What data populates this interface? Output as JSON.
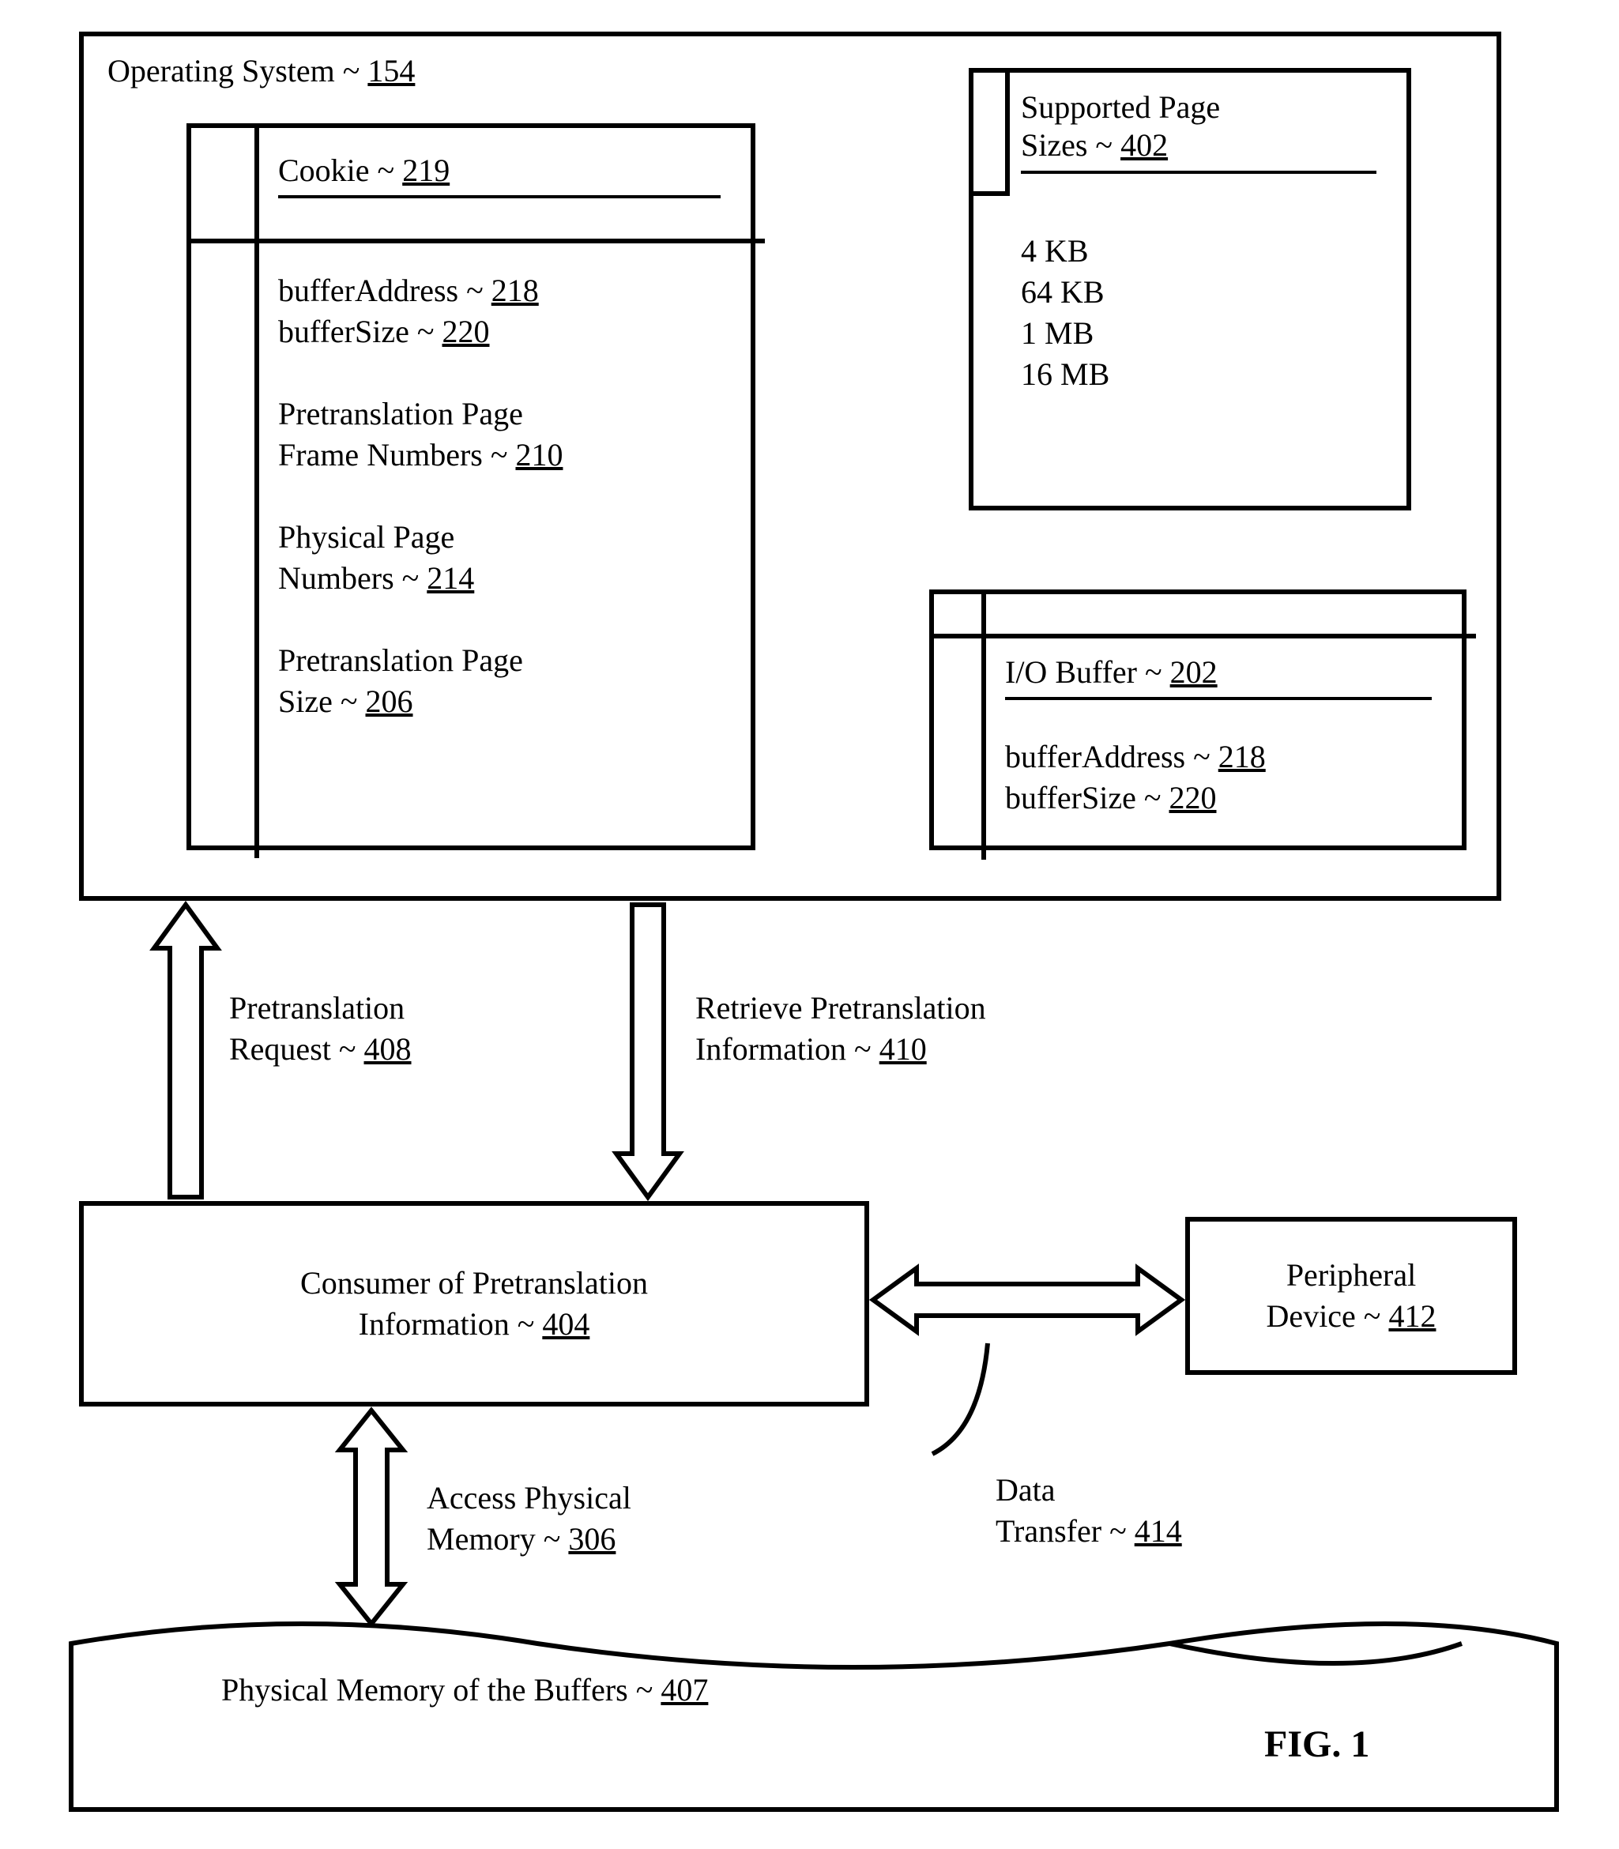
{
  "os": {
    "title_text": "Operating System ~ ",
    "title_ref": "154"
  },
  "cookie": {
    "header_text": "Cookie ~ ",
    "header_ref": "219",
    "line1_text": "bufferAddress ~ ",
    "line1_ref": "218",
    "line2_text": "bufferSize ~ ",
    "line2_ref": "220",
    "line3a": "Pretranslation Page",
    "line3b_text": "Frame Numbers ~ ",
    "line3b_ref": "210",
    "line4a": "Physical Page",
    "line4b_text": "Numbers ~ ",
    "line4b_ref": "214",
    "line5a": "Pretranslation Page",
    "line5b_text": "Size ~ ",
    "line5b_ref": "206"
  },
  "supported": {
    "header_line1": "Supported Page",
    "header_line2_text": "Sizes ~ ",
    "header_line2_ref": "402",
    "size1": "4 KB",
    "size2": "64 KB",
    "size3": "1 MB",
    "size4": "16 MB"
  },
  "iobuffer": {
    "header_text": "I/O Buffer ~ ",
    "header_ref": "202",
    "line1_text": "bufferAddress ~ ",
    "line1_ref": "218",
    "line2_text": "bufferSize ~ ",
    "line2_ref": "220"
  },
  "consumer": {
    "line1": "Consumer of Pretranslation",
    "line2_text": "Information ~ ",
    "line2_ref": "404"
  },
  "peripheral": {
    "line1": "Peripheral",
    "line2_text": "Device ~ ",
    "line2_ref": "412"
  },
  "labels": {
    "pretrans_req_line1": "Pretranslation",
    "pretrans_req_line2_text": "Request ~ ",
    "pretrans_req_line2_ref": "408",
    "retrieve_line1": "Retrieve Pretranslation",
    "retrieve_line2_text": "Information ~ ",
    "retrieve_line2_ref": "410",
    "access_line1": "Access Physical",
    "access_line2_text": "Memory ~ ",
    "access_line2_ref": "306",
    "data_transfer_line1": "Data",
    "data_transfer_line2_text": "Transfer ~ ",
    "data_transfer_line2_ref": "414",
    "physical_mem_text": "Physical Memory of the Buffers ~ ",
    "physical_mem_ref": "407",
    "fig": "FIG. 1"
  }
}
